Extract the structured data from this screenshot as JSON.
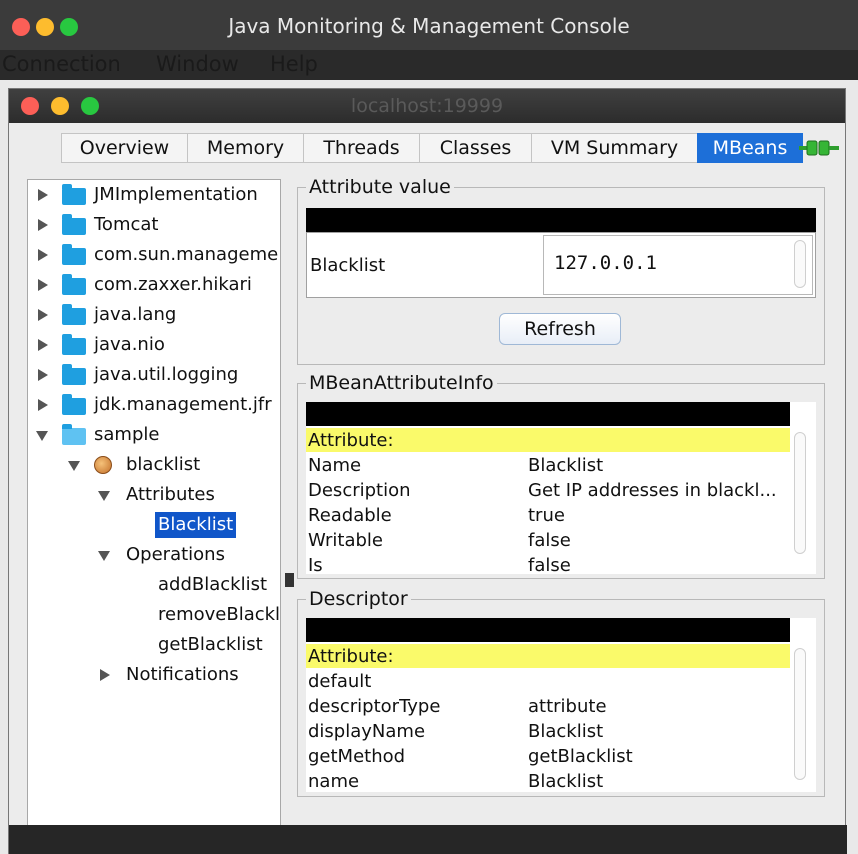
{
  "app": {
    "title": "Java Monitoring & Management Console",
    "inner_title": "localhost:19999"
  },
  "menu": [
    "Connection",
    "Window",
    "Help"
  ],
  "tabs": [
    {
      "label": "Overview",
      "active": false
    },
    {
      "label": "Memory",
      "active": false
    },
    {
      "label": "Threads",
      "active": false
    },
    {
      "label": "Classes",
      "active": false
    },
    {
      "label": "VM Summary",
      "active": false
    },
    {
      "label": "MBeans",
      "active": true
    }
  ],
  "tree": {
    "domains": [
      "JMImplementation",
      "Tomcat",
      "com.sun.manageme",
      "com.zaxxer.hikari",
      "java.lang",
      "java.nio",
      "java.util.logging",
      "jdk.management.jfr",
      "sample"
    ],
    "bean": "blacklist",
    "attributes_label": "Attributes",
    "selected_attribute": "Blacklist",
    "operations_label": "Operations",
    "operations": [
      "addBlacklist",
      "removeBlackl",
      "getBlacklist"
    ],
    "notifications_label": "Notifications"
  },
  "attribute_value": {
    "title": "Attribute value",
    "name": "Blacklist",
    "value": "127.0.0.1",
    "refresh_label": "Refresh"
  },
  "attribute_info": {
    "title": "MBeanAttributeInfo",
    "header": "Attribute:",
    "rows": [
      {
        "key": "Name",
        "value": "Blacklist"
      },
      {
        "key": "Description",
        "value": "Get IP addresses in blackl..."
      },
      {
        "key": "Readable",
        "value": "true"
      },
      {
        "key": "Writable",
        "value": "false"
      },
      {
        "key": "Is",
        "value": "false"
      }
    ]
  },
  "descriptor": {
    "title": "Descriptor",
    "header": "Attribute:",
    "rows": [
      {
        "key": "default",
        "value": ""
      },
      {
        "key": "descriptorType",
        "value": "attribute"
      },
      {
        "key": "displayName",
        "value": "Blacklist"
      },
      {
        "key": "getMethod",
        "value": "getBlacklist"
      },
      {
        "key": "name",
        "value": "Blacklist"
      }
    ]
  },
  "colors": {
    "tab_active": "#1d6fd8",
    "selection": "#1056c9",
    "highlight": "#fafa6a",
    "folder": "#1f9fe0"
  }
}
